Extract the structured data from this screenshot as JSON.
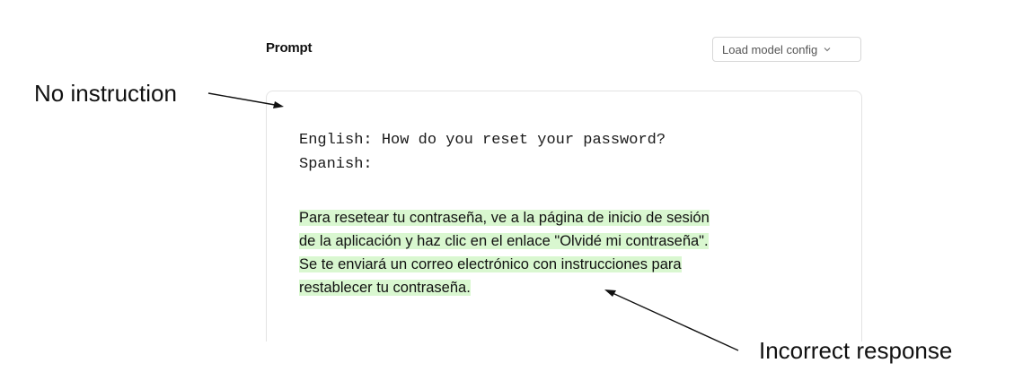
{
  "header": {
    "prompt_label": "Prompt",
    "config_select": {
      "value": "Load model config",
      "icon": "chevron-down-icon"
    }
  },
  "annotations": {
    "left": "No instruction",
    "right": "Incorrect response"
  },
  "editor": {
    "prompt_lines": [
      "English: How do you reset your password?",
      "Spanish:"
    ],
    "response_lines": [
      "Para resetear tu contraseña, ve a la página de inicio de sesión",
      "de la aplicación y haz clic en el enlace \"Olvidé mi contraseña\".",
      "Se te enviará un correo electrónico con instrucciones para",
      "restablecer tu contraseña."
    ],
    "highlight_color": "#d9f7d0"
  }
}
